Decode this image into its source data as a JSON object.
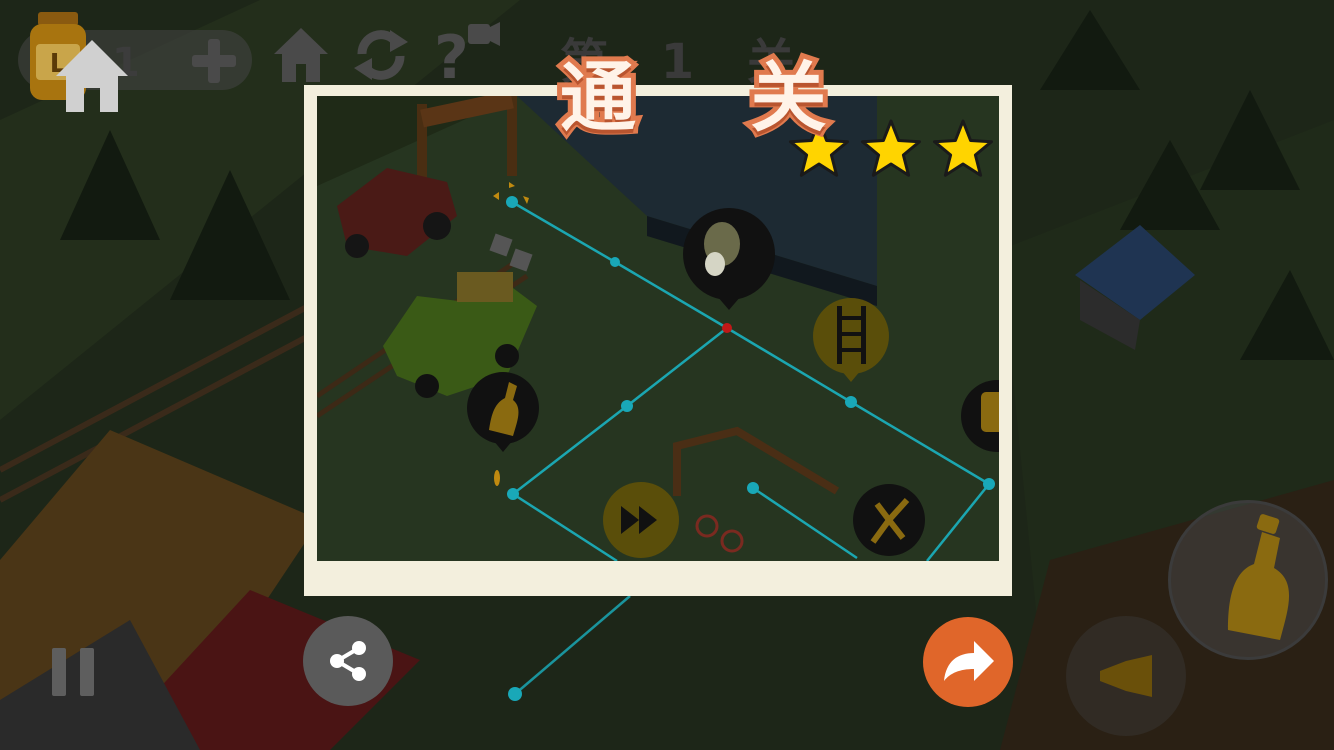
{
  "game": {
    "hud": {
      "fuel_count": "1",
      "level_label": "第 1 关"
    },
    "dialog": {
      "title": "通 关",
      "stars_earned": 3,
      "stars_total": 3
    },
    "icons": {
      "fuel_can": "fuel-can-icon",
      "add": "plus-icon",
      "home_bg": "home-icon",
      "restart": "restart-icon",
      "hint": "video-hint-icon",
      "home": "home-icon",
      "share": "share-icon",
      "next": "next-arrow-icon",
      "pause": "pause-icon",
      "item_bottle": "bottle-icon",
      "item_honk": "horn-icon"
    },
    "colors": {
      "dialog_bg": "#f3efdd",
      "title_fill": "#fff3e8",
      "title_stroke": "#e07a4e",
      "star": "#ffd400",
      "next_button": "#e0662a",
      "share_button": "#5a5a5a",
      "path_line": "#19c3d6"
    }
  }
}
